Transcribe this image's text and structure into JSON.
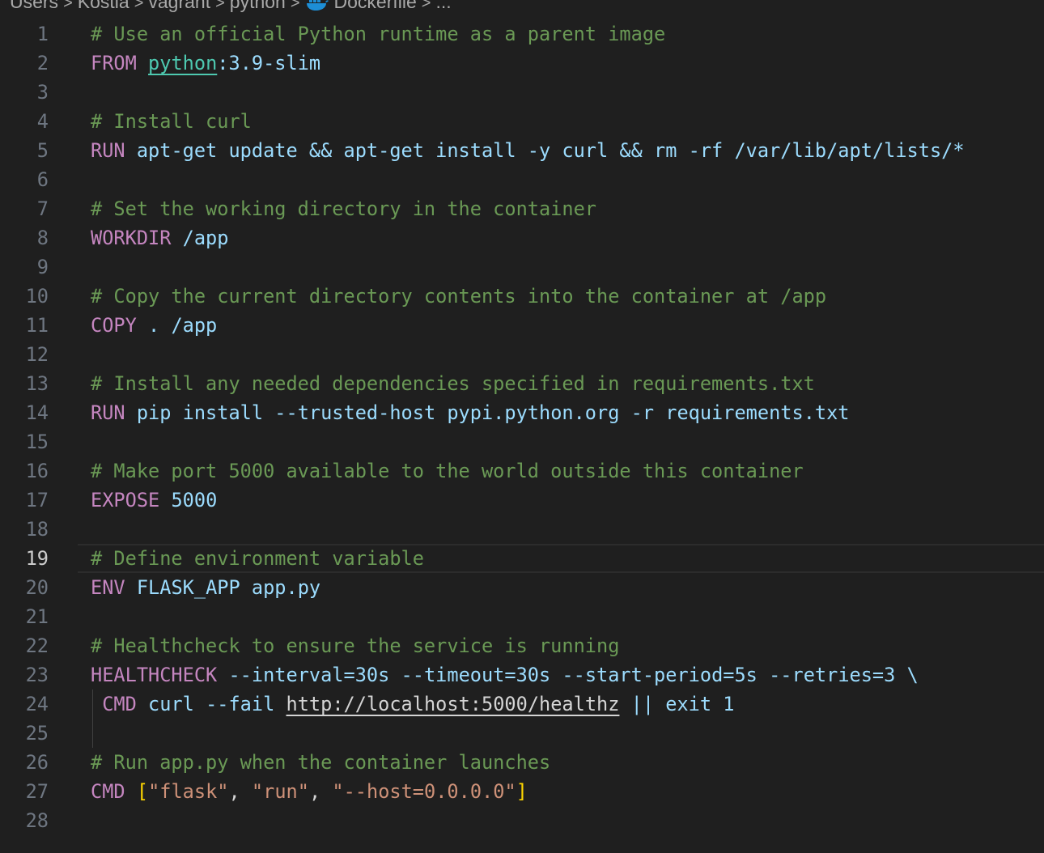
{
  "breadcrumb": {
    "items": [
      "Users",
      "Kostia",
      "vagrant",
      "python",
      "Dockerfile",
      "..."
    ],
    "separator": ">"
  },
  "editor": {
    "current_line": 19,
    "lines": [
      {
        "n": "1",
        "tokens": [
          {
            "c": "comment",
            "t": "# Use an official Python runtime as a parent image"
          }
        ]
      },
      {
        "n": "2",
        "tokens": [
          {
            "c": "keyword",
            "t": "FROM"
          },
          {
            "c": "text",
            "t": " "
          },
          {
            "c": "image",
            "t": "python"
          },
          {
            "c": "var",
            "t": ":3.9-slim"
          }
        ]
      },
      {
        "n": "3",
        "tokens": []
      },
      {
        "n": "4",
        "tokens": [
          {
            "c": "comment",
            "t": "# Install curl"
          }
        ]
      },
      {
        "n": "5",
        "tokens": [
          {
            "c": "keyword",
            "t": "RUN"
          },
          {
            "c": "var",
            "t": " apt-get update && apt-get install -y curl && rm -rf /var/lib/apt/lists/*"
          }
        ]
      },
      {
        "n": "6",
        "tokens": []
      },
      {
        "n": "7",
        "tokens": [
          {
            "c": "comment",
            "t": "# Set the working directory in the container"
          }
        ]
      },
      {
        "n": "8",
        "tokens": [
          {
            "c": "keyword",
            "t": "WORKDIR"
          },
          {
            "c": "var",
            "t": " /app"
          }
        ]
      },
      {
        "n": "9",
        "tokens": []
      },
      {
        "n": "10",
        "tokens": [
          {
            "c": "comment",
            "t": "# Copy the current directory contents into the container at /app"
          }
        ]
      },
      {
        "n": "11",
        "tokens": [
          {
            "c": "keyword",
            "t": "COPY"
          },
          {
            "c": "var",
            "t": " . /app"
          }
        ]
      },
      {
        "n": "12",
        "tokens": []
      },
      {
        "n": "13",
        "tokens": [
          {
            "c": "comment",
            "t": "# Install any needed dependencies specified in requirements.txt"
          }
        ]
      },
      {
        "n": "14",
        "tokens": [
          {
            "c": "keyword",
            "t": "RUN"
          },
          {
            "c": "var",
            "t": " pip install --trusted-host pypi.python.org -r requirements.txt"
          }
        ]
      },
      {
        "n": "15",
        "tokens": []
      },
      {
        "n": "16",
        "tokens": [
          {
            "c": "comment",
            "t": "# Make port 5000 available to the world outside this container"
          }
        ]
      },
      {
        "n": "17",
        "tokens": [
          {
            "c": "keyword",
            "t": "EXPOSE"
          },
          {
            "c": "text",
            "t": " "
          },
          {
            "c": "var",
            "t": "5000"
          }
        ]
      },
      {
        "n": "18",
        "tokens": []
      },
      {
        "n": "19",
        "tokens": [
          {
            "c": "comment",
            "t": "# Define environment variable"
          }
        ]
      },
      {
        "n": "20",
        "tokens": [
          {
            "c": "keyword",
            "t": "ENV"
          },
          {
            "c": "text",
            "t": " "
          },
          {
            "c": "var",
            "t": "FLASK_APP app.py"
          }
        ]
      },
      {
        "n": "21",
        "tokens": []
      },
      {
        "n": "22",
        "tokens": [
          {
            "c": "comment",
            "t": "# Healthcheck to ensure the service is running"
          }
        ]
      },
      {
        "n": "23",
        "tokens": [
          {
            "c": "keyword",
            "t": "HEALTHCHECK"
          },
          {
            "c": "var",
            "t": " --interval=30s --timeout=30s --start-period=5s --retries=3 "
          },
          {
            "c": "flag",
            "t": "\\"
          }
        ]
      },
      {
        "n": "24",
        "tokens": [
          {
            "c": "text",
            "t": " "
          },
          {
            "c": "keyword",
            "t": "CMD"
          },
          {
            "c": "var",
            "t": " curl --fail "
          },
          {
            "c": "link",
            "t": "http://localhost:5000/healthz"
          },
          {
            "c": "var",
            "t": " || exit 1"
          }
        ]
      },
      {
        "n": "25",
        "tokens": []
      },
      {
        "n": "26",
        "tokens": [
          {
            "c": "comment",
            "t": "# Run app.py when the container launches"
          }
        ]
      },
      {
        "n": "27",
        "tokens": [
          {
            "c": "keyword",
            "t": "CMD"
          },
          {
            "c": "text",
            "t": " "
          },
          {
            "c": "bracket",
            "t": "["
          },
          {
            "c": "str",
            "t": "\"flask\""
          },
          {
            "c": "text",
            "t": ", "
          },
          {
            "c": "str",
            "t": "\"run\""
          },
          {
            "c": "text",
            "t": ", "
          },
          {
            "c": "str",
            "t": "\"--host=0.0.0.0\""
          },
          {
            "c": "bracket",
            "t": "]"
          }
        ]
      },
      {
        "n": "28",
        "tokens": []
      }
    ]
  },
  "colors": {
    "background": "#1f1f1f",
    "comment": "#6a9955",
    "keyword": "#c586c0",
    "variable": "#9cdcfe",
    "string": "#ce9178",
    "image": "#4ec9b0",
    "line_number": "#6e7681",
    "line_number_active": "#cccccc"
  },
  "icons": {
    "breadcrumb_file": "docker-whale-icon"
  }
}
